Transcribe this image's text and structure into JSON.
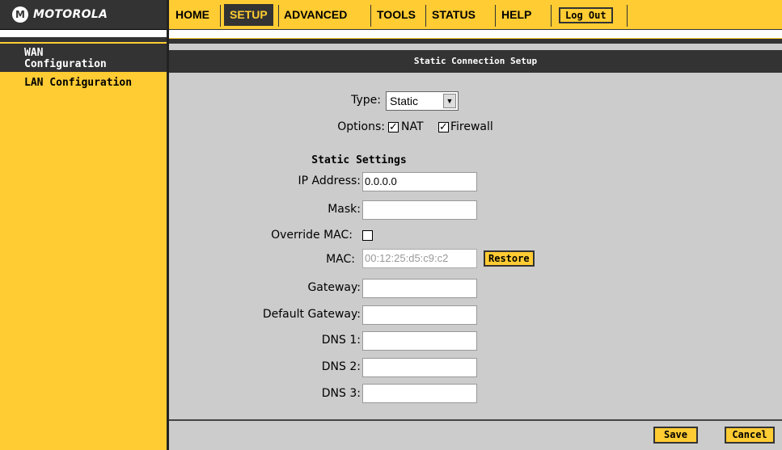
{
  "brand": {
    "name": "MOTOROLA",
    "logo_mark": "M"
  },
  "nav": {
    "items": [
      "HOME",
      "SETUP",
      "ADVANCED",
      "TOOLS",
      "STATUS",
      "HELP"
    ],
    "active": "SETUP",
    "logout_label": "Log Out"
  },
  "sidebar": {
    "items": [
      "WAN Configuration",
      "LAN Configuration"
    ],
    "wan_line1": "WAN",
    "wan_line2": "Configuration",
    "lan_label": "LAN Configuration"
  },
  "main": {
    "section_title": "Static Connection Setup",
    "type_label": "Type:",
    "type_value": "Static",
    "options_label": "Options:",
    "nat_label": "NAT",
    "nat_checked": true,
    "firewall_label": "Firewall",
    "firewall_checked": true,
    "static_heading": "Static Settings",
    "fields": {
      "ip_label": "IP Address:",
      "ip_value": "0.0.0.0",
      "mask_label": "Mask:",
      "mask_value": "",
      "override_mac_label": "Override MAC:",
      "override_mac_checked": false,
      "mac_label": "MAC:",
      "mac_value": "00:12:25:d5:c9:c2",
      "gateway_label": "Gateway:",
      "gateway_value": "",
      "default_gateway_label": "Default Gateway:",
      "default_gateway_value": "",
      "dns1_label": "DNS 1:",
      "dns1_value": "",
      "dns2_label": "DNS 2:",
      "dns2_value": "",
      "dns3_label": "DNS 3:",
      "dns3_value": ""
    },
    "restore_label": "Restore",
    "save_label": "Save",
    "cancel_label": "Cancel"
  },
  "colors": {
    "accent": "#ffcc33",
    "dark": "#333333",
    "panel": "#cccccc"
  }
}
